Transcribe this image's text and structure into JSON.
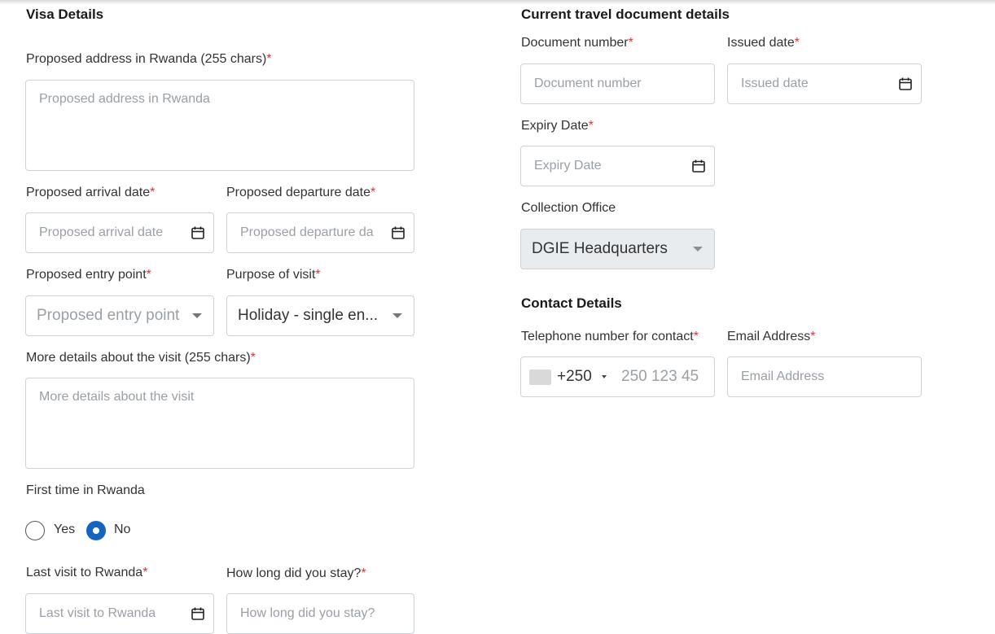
{
  "left": {
    "section_title": "Visa Details",
    "address": {
      "label": "Proposed address in Rwanda (255 chars)",
      "placeholder": "Proposed address in Rwanda"
    },
    "arrival": {
      "label": "Proposed arrival date",
      "placeholder": "Proposed arrival date"
    },
    "departure": {
      "label": "Proposed departure date",
      "placeholder": "Proposed departure da"
    },
    "entry_point": {
      "label": "Proposed entry point",
      "placeholder": "Proposed entry point"
    },
    "purpose": {
      "label": "Purpose of visit",
      "value": "Holiday - single en..."
    },
    "more_details": {
      "label": "More details about the visit (255 chars)",
      "placeholder": "More details about the visit"
    },
    "first_time": {
      "label": "First time in Rwanda",
      "yes": "Yes",
      "no": "No",
      "selected": "No"
    },
    "last_visit": {
      "label": "Last visit to Rwanda",
      "placeholder": "Last visit to Rwanda"
    },
    "stay": {
      "label": "How long did you stay?",
      "placeholder": "How long did you stay?"
    }
  },
  "right": {
    "section_title": "Current travel document details",
    "doc_number": {
      "label": "Document number",
      "placeholder": "Document number"
    },
    "issued": {
      "label": "Issued date",
      "placeholder": "Issued date"
    },
    "expiry": {
      "label": "Expiry Date",
      "placeholder": "Expiry Date"
    },
    "collection": {
      "label": "Collection Office",
      "value": "DGIE Headquarters"
    },
    "contact_title": "Contact Details",
    "phone": {
      "label": "Telephone number for contact",
      "code": "+250",
      "placeholder": "250 123 45"
    },
    "email": {
      "label": "Email Address",
      "placeholder": "Email Address"
    }
  },
  "required_mark": "*",
  "colors": {
    "accent": "#1565c0",
    "required": "#e0343a",
    "border": "#cfd3d7",
    "disabled_bg": "#e9ecef"
  }
}
